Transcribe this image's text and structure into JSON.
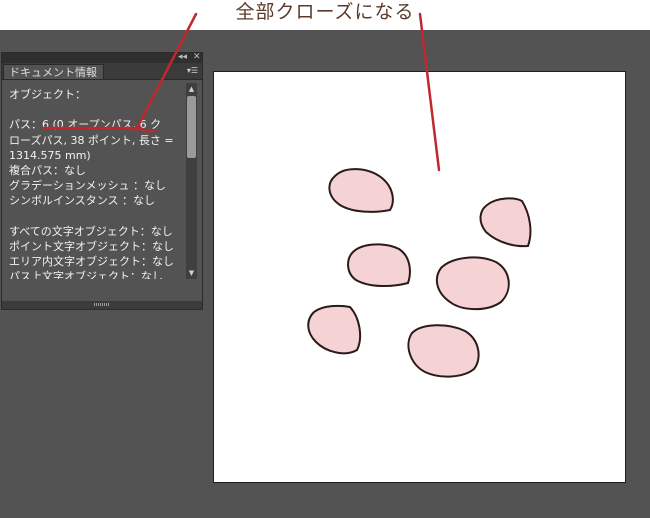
{
  "annotation": {
    "text": "全部クローズになる",
    "color": "#c0282d"
  },
  "panel": {
    "tab_label": "ドキュメント情報",
    "controls": {
      "collapse_icon": "double-chevron-icon",
      "close_icon": "close-icon",
      "menu_icon": "panel-menu-icon"
    },
    "lines": [
      "オブジェクト：",
      "",
      "パス：6 (0 オープンパス, 6 ク",
      "ローズパス, 38 ポイント, 長さ =",
      "1314.575 mm)",
      "複合パス：なし",
      "グラデーションメッシュ ：なし",
      "シンボルインスタンス ：なし",
      "",
      "すべての文字オブジェクト：なし",
      "ポイント文字オブジェクト：なし",
      "エリア内文字オブジェクト：なし",
      "パス上文字オブジェクト：なし"
    ]
  },
  "artboard": {
    "shape_fill": "#f5d3d4",
    "shape_stroke": "#2a1a1a",
    "shape_count": 6
  }
}
